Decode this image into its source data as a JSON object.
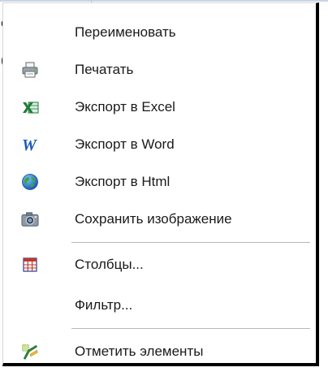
{
  "menu": {
    "items": [
      {
        "label": "Переименовать",
        "icon": "none"
      },
      {
        "label": "Печатать",
        "icon": "printer-icon"
      },
      {
        "label": "Экспорт в Excel",
        "icon": "excel-icon"
      },
      {
        "label": "Экспорт в Word",
        "icon": "word-icon"
      },
      {
        "label": "Экспорт в Html",
        "icon": "globe-icon"
      },
      {
        "label": "Сохранить изображение",
        "icon": "camera-icon"
      },
      {
        "label": "Столбцы...",
        "icon": "columns-grid-icon"
      },
      {
        "label": "Фильтр...",
        "icon": "none"
      },
      {
        "label": "Отметить элементы",
        "icon": "mark-items-icon"
      }
    ]
  },
  "background": {
    "fragment_top": "e",
    "fragment_mid": "("
  },
  "colors": {
    "excel_green": "#1f7a3a",
    "word_blue": "#1c5ab5",
    "columns_red": "#c0392b",
    "separator": "#b8b8b8"
  }
}
